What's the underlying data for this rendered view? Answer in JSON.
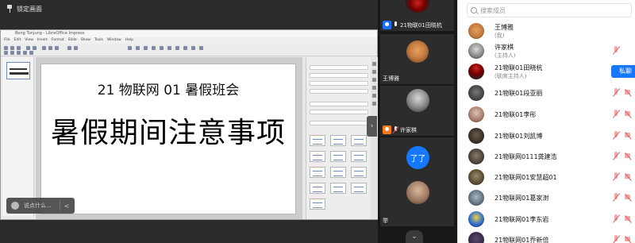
{
  "share": {
    "lock_label": "锁定画面",
    "window_title": "Beng Tunjung - LibreOffice Impress",
    "menu": [
      "File",
      "Edit",
      "View",
      "Insert",
      "Format",
      "Slide",
      "Show",
      "Tools",
      "Window",
      "Help"
    ],
    "slide": {
      "subtitle": "21 物联网 01 暑假班会",
      "title": "暑假期间注意事项"
    },
    "say_placeholder": "说点什么...",
    "say_chevron": "<"
  },
  "videos": [
    {
      "name": "21物联01田晓杭",
      "badge": "host",
      "mic": "on"
    },
    {
      "name": "王博雅",
      "badge": "none",
      "mic": "none"
    },
    {
      "name": "许家棋",
      "badge": "cohost",
      "mic": "off"
    },
    {
      "name": "了了",
      "badge": "none",
      "mic": "off",
      "avatar_text": "了了"
    },
    {
      "name": "举",
      "badge": "none",
      "mic": "none"
    }
  ],
  "members": {
    "search_placeholder": "搜索成员",
    "list": [
      {
        "name": "王博雅",
        "role": "(我)"
      },
      {
        "name": "许家棋",
        "role": "(主持人)"
      },
      {
        "name": "21物联01田晓杭",
        "role": "(联席主持人)",
        "action": "私聊"
      },
      {
        "name": "21物联01段亚丽",
        "role": ""
      },
      {
        "name": "21物联01李彤",
        "role": ""
      },
      {
        "name": "21物联01刘凯博",
        "role": ""
      },
      {
        "name": "21物联网0111龚建浩",
        "role": ""
      },
      {
        "name": "21物联网01安慧超01",
        "role": ""
      },
      {
        "name": "21物联网01葛家澍",
        "role": ""
      },
      {
        "name": "21物联网01李东岩",
        "role": ""
      },
      {
        "name": "21物联网01乔新倍",
        "role": ""
      }
    ]
  },
  "colors": {
    "accent": "#1677ff",
    "cohost": "#ff7a1a",
    "muted": "#e35a5a"
  }
}
